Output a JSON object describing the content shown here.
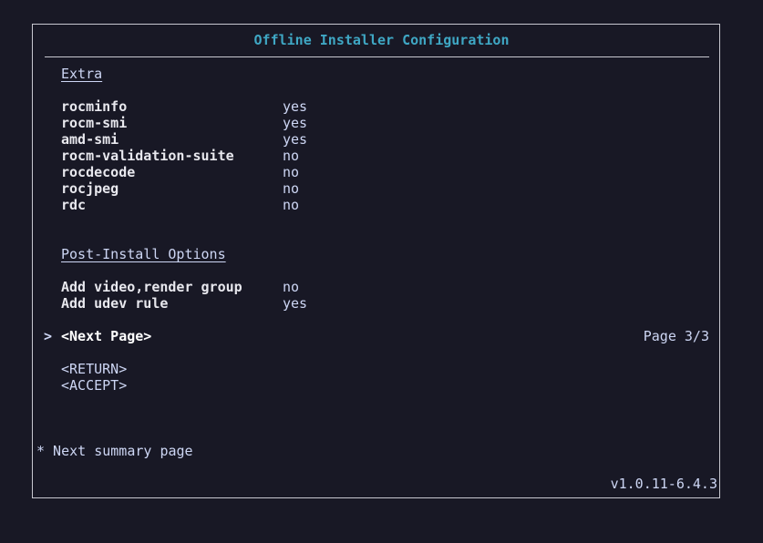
{
  "app": {
    "title": "Offline Installer Configuration"
  },
  "extra": {
    "heading": "Extra",
    "items": [
      {
        "label": "rocminfo",
        "value": "yes"
      },
      {
        "label": "rocm-smi",
        "value": "yes"
      },
      {
        "label": "amd-smi",
        "value": "yes"
      },
      {
        "label": "rocm-validation-suite",
        "value": "no"
      },
      {
        "label": "rocdecode",
        "value": "no"
      },
      {
        "label": "rocjpeg",
        "value": "no"
      },
      {
        "label": "rdc",
        "value": "no"
      }
    ]
  },
  "post_install": {
    "heading": "Post-Install Options",
    "items": [
      {
        "label": "Add video,render group",
        "value": "no"
      },
      {
        "label": "Add udev rule",
        "value": "yes"
      }
    ]
  },
  "nav": {
    "cursor": ">",
    "next_page_label": "<Next Page>",
    "page_indicator": "Page 3/3",
    "return_label": "<RETURN>",
    "accept_label": "<ACCEPT>"
  },
  "footer": {
    "hint": "* Next summary page",
    "version": "v1.0.11-6.4.3"
  },
  "colors": {
    "background": "#181825",
    "title": "#3fa7c4",
    "border": "#c8c8d0",
    "text": "#cdd6f4"
  }
}
